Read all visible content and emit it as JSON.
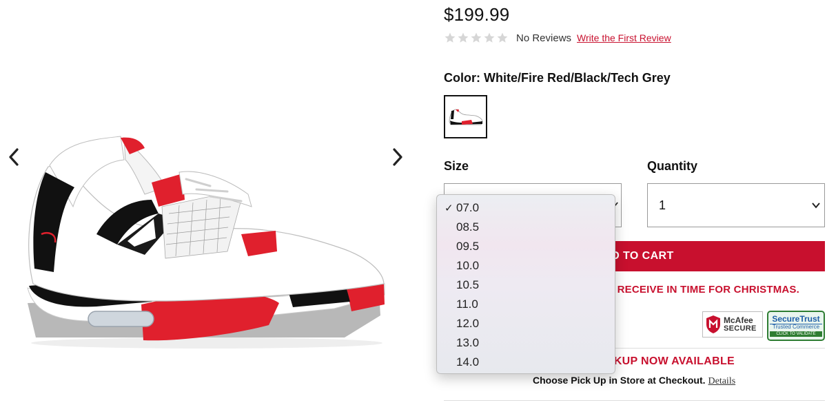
{
  "product": {
    "price": "$199.99",
    "rating": {
      "stars": 0,
      "max_stars": 5,
      "no_reviews_label": "No Reviews",
      "write_review_link": "Write the First Review"
    },
    "color_label": "Color: White/Fire Red/Black/Tech Grey"
  },
  "size": {
    "label": "Size",
    "selected": "07.0",
    "options": [
      "07.0",
      "08.5",
      "09.5",
      "10.0",
      "10.5",
      "11.0",
      "12.0",
      "13.0",
      "14.0"
    ]
  },
  "quantity": {
    "label": "Quantity",
    "value": "1"
  },
  "cart": {
    "button_label": "ADD TO CART",
    "christmas_notice": "RECEIVE IN TIME FOR CHRISTMAS."
  },
  "badges": {
    "mcafee": {
      "line1": "McAfee",
      "line2": "SECURE"
    },
    "securetrust": {
      "line1": "SecureTrust",
      "line2": "Trusted Commerce",
      "line3": "CLICK TO VALIDATE"
    }
  },
  "pickup": {
    "title": "KUP NOW AVAILABLE",
    "text": "Choose Pick Up in Store at Checkout.",
    "details_link": "Details"
  },
  "colors": {
    "brand_red": "#c8102e",
    "star_empty": "#d6d6d6"
  },
  "icons": {
    "prev": "chevron-left-icon",
    "next": "chevron-right-icon",
    "star": "star-icon"
  }
}
